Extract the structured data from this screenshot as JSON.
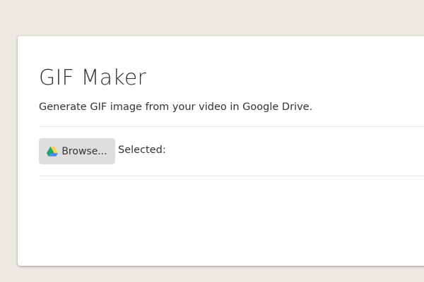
{
  "app": {
    "title": "GIF Maker",
    "subtitle": "Generate GIF image from your video in Google Drive."
  },
  "picker": {
    "browse_label": "Browse...",
    "browse_icon": "google-drive-icon",
    "selected_label": "Selected:",
    "selected_value": ""
  },
  "colors": {
    "page_background": "#ece9e3",
    "card_background": "#ffffff",
    "button_background": "#dedede",
    "drive_green": "#1fa463",
    "drive_yellow": "#ffd04b",
    "drive_blue": "#4688f4"
  }
}
